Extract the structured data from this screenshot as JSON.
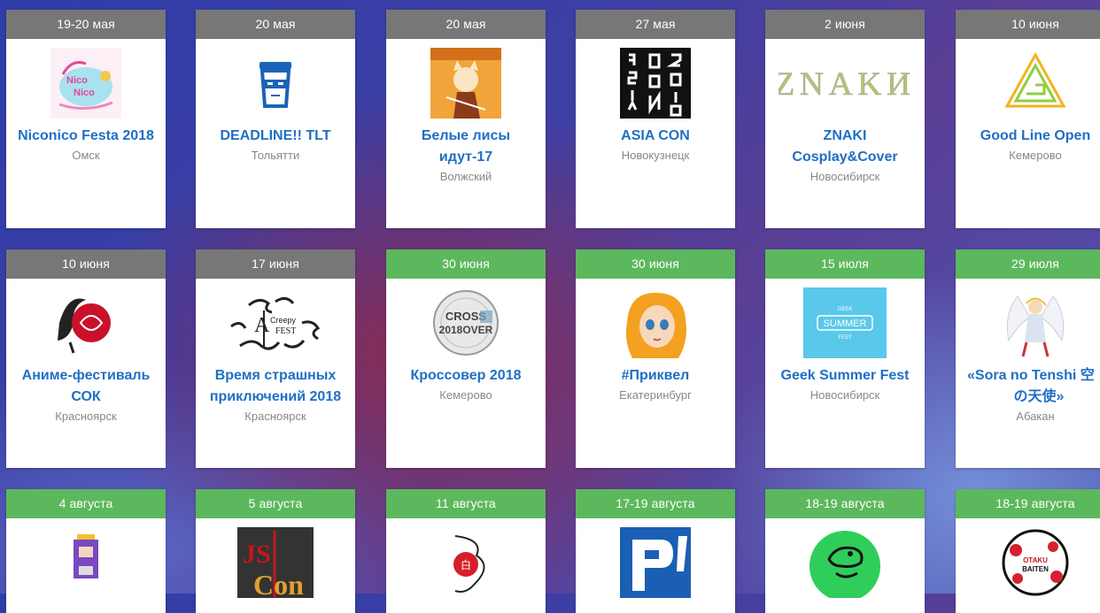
{
  "events": [
    {
      "date": "19-20 мая",
      "status": "past",
      "title": [
        "Niconico Festa 2018"
      ],
      "city": "Омск",
      "image": "niconico-logo"
    },
    {
      "date": "20 мая",
      "status": "past",
      "title": [
        "DEADLINE!! TLT"
      ],
      "city": "Тольятти",
      "image": "coffee-cup-logo"
    },
    {
      "date": "20 мая",
      "status": "past",
      "title": [
        "Белые лисы",
        "идут-17"
      ],
      "city": "Волжский",
      "image": "fox-poster"
    },
    {
      "date": "27 мая",
      "status": "past",
      "title": [
        "ASIA CON"
      ],
      "city": "Новокузнецк",
      "image": "asia-con-logo"
    },
    {
      "date": "2 июня",
      "status": "past",
      "title": [
        "ZNAKI",
        "Cosplay&Cover"
      ],
      "city": "Новосибирск",
      "image": "znaki-logo",
      "image_text": "ZNAKИ"
    },
    {
      "date": "10 июня",
      "status": "past",
      "title": [
        "Good Line Open"
      ],
      "city": "Кемерово",
      "image": "good-line-logo"
    },
    {
      "date": "10 июня",
      "status": "past",
      "title": [
        "Аниме-фестиваль",
        "СОК"
      ],
      "city": "Красноярск",
      "image": "sok-logo"
    },
    {
      "date": "17 июня",
      "status": "past",
      "title": [
        "Время страшных",
        "приключений 2018"
      ],
      "city": "Красноярск",
      "image": "creepy-fest-logo"
    },
    {
      "date": "30 июня",
      "status": "future",
      "title": [
        "Кроссовер 2018"
      ],
      "city": "Кемерово",
      "image": "crossover-logo"
    },
    {
      "date": "30 июня",
      "status": "future",
      "title": [
        "#Приквел"
      ],
      "city": "Екатеринбург",
      "image": "prequel-art"
    },
    {
      "date": "15 июля",
      "status": "future",
      "title": [
        "Geek Summer Fest"
      ],
      "city": "Новосибирск",
      "image": "summer-fest-logo"
    },
    {
      "date": "29 июля",
      "status": "future",
      "title": [
        "«Sora no Tenshi 空",
        "の天使»"
      ],
      "city": "Абакан",
      "image": "angel-art"
    },
    {
      "date": "4 августа",
      "status": "future",
      "title": [],
      "city": "",
      "image": "pixel-character"
    },
    {
      "date": "5 августа",
      "status": "future",
      "title": [],
      "city": "",
      "image": "jscon-logo",
      "image_text": "JS Con"
    },
    {
      "date": "11 августа",
      "status": "future",
      "title": [],
      "city": "",
      "image": "white-dragon-logo"
    },
    {
      "date": "17-19 августа",
      "status": "future",
      "title": [],
      "city": "",
      "image": "p-logo"
    },
    {
      "date": "18-19 августа",
      "status": "future",
      "title": [],
      "city": "",
      "image": "turtle-logo"
    },
    {
      "date": "18-19 августа",
      "status": "future",
      "title": [],
      "city": "",
      "image": "otaku-baiten-logo",
      "image_text": "СИБИРЬ OTAKU BAITEN"
    }
  ]
}
